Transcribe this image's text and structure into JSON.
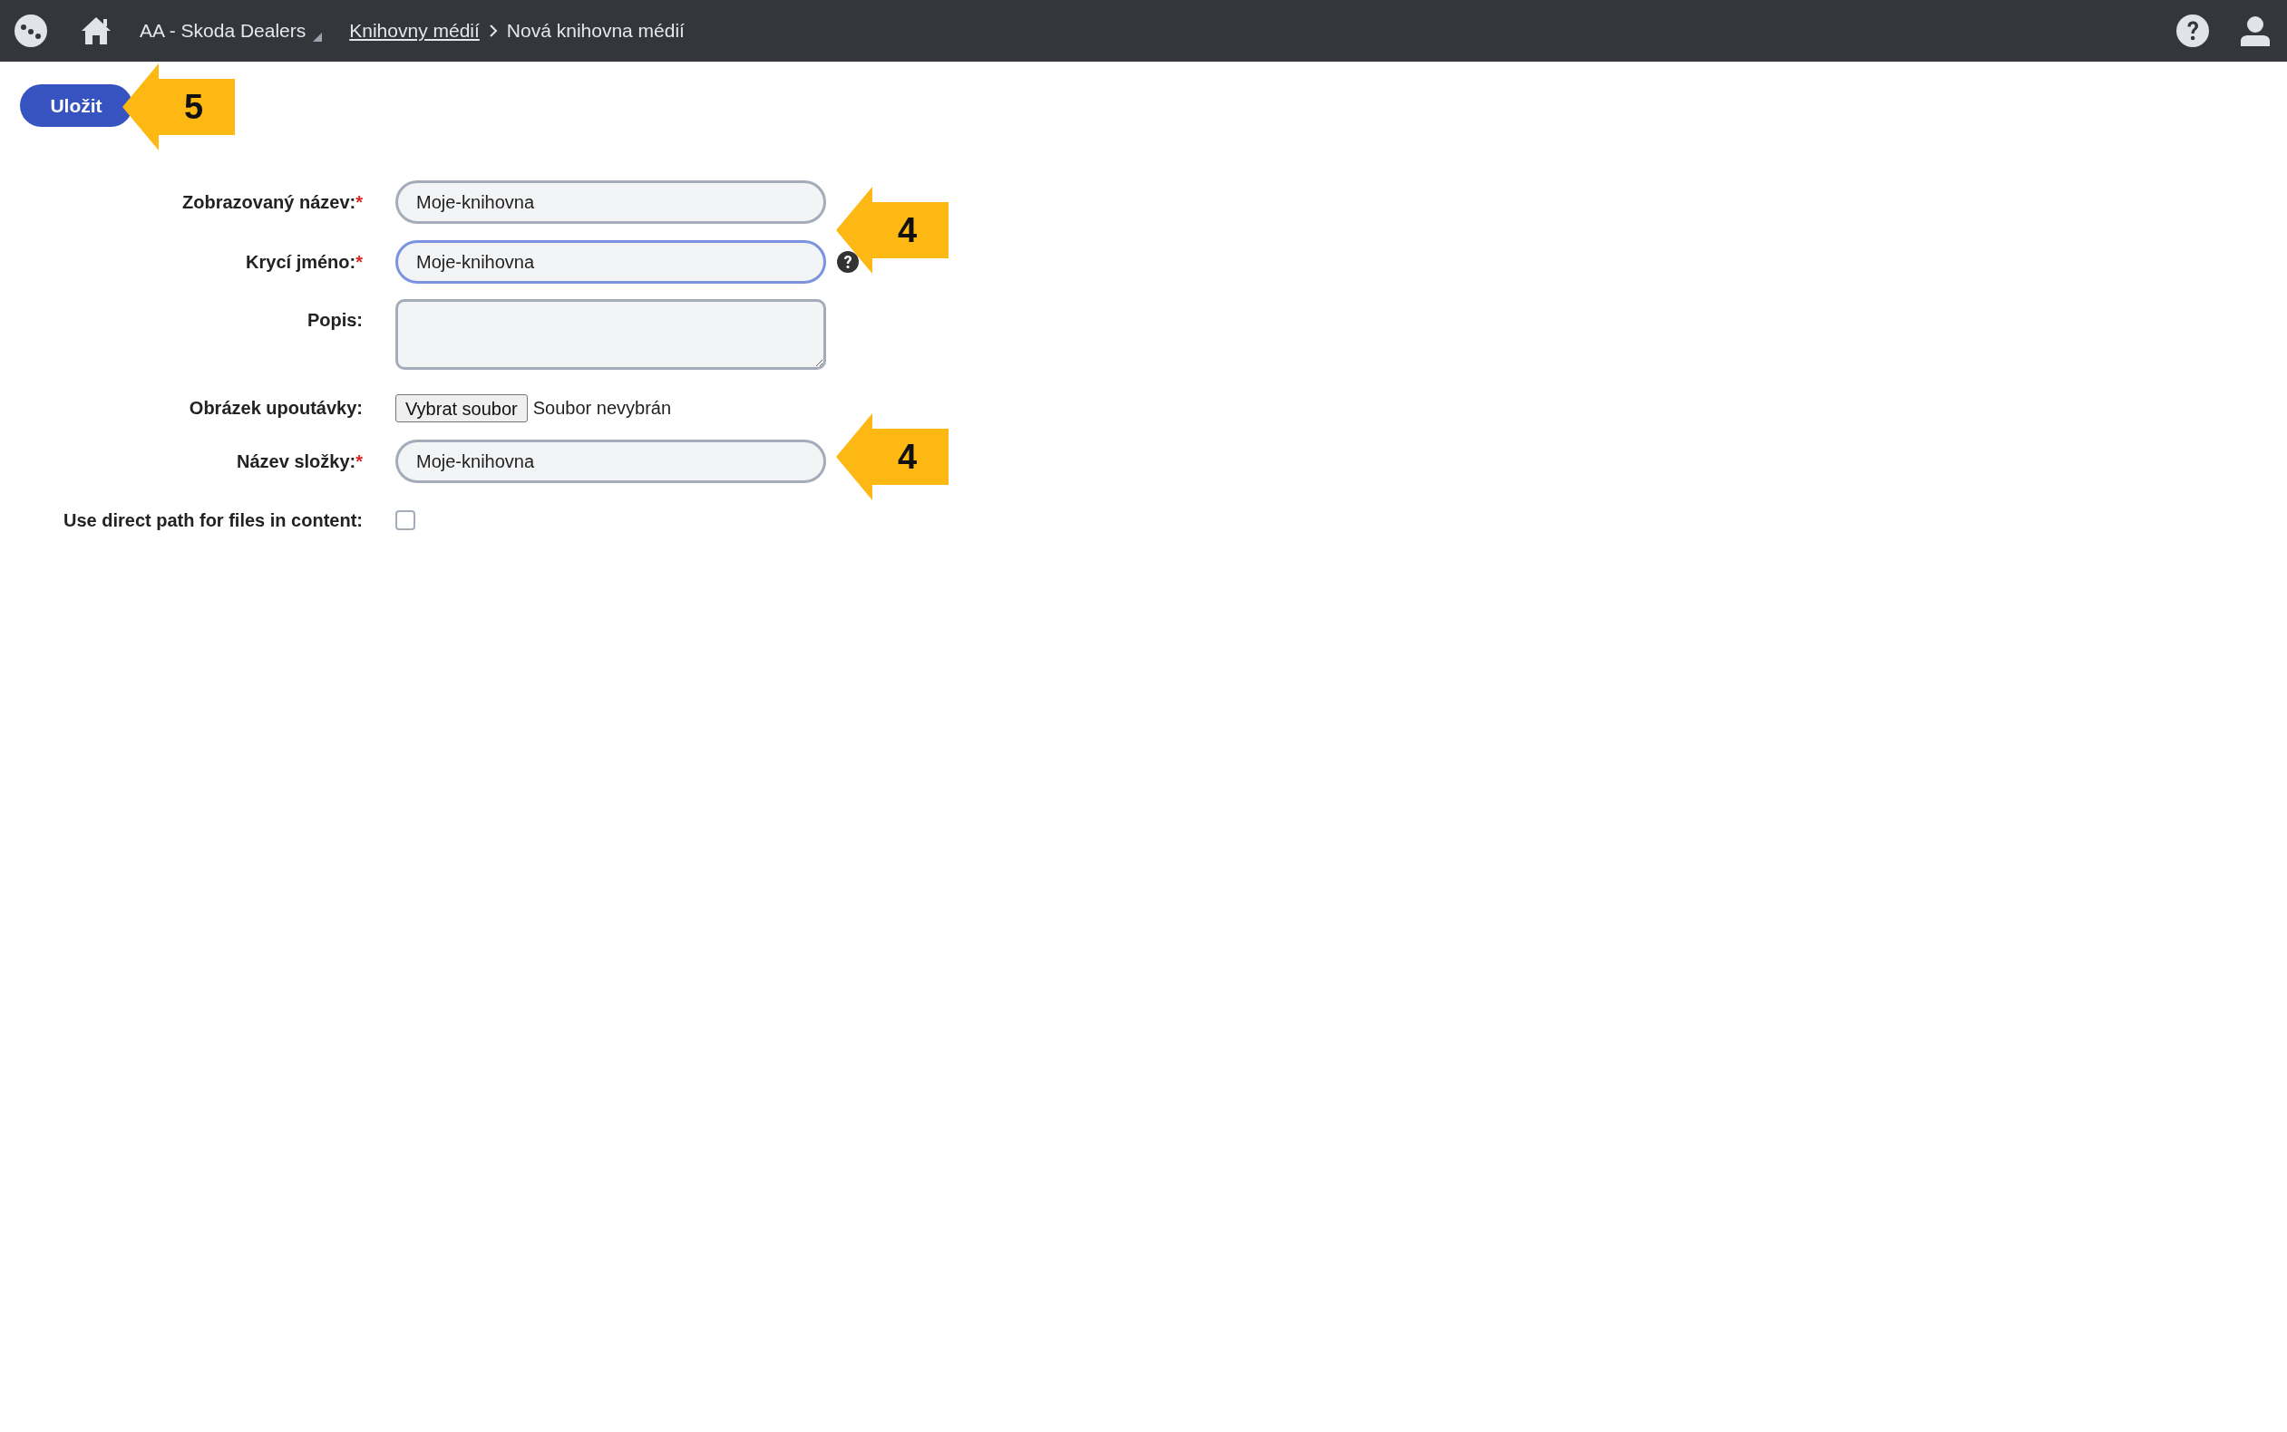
{
  "header": {
    "workspace": "AA - Skoda Dealers",
    "breadcrumb": [
      {
        "label": "Knihovny médií",
        "link": true
      },
      {
        "label": "Nová knihovna médií",
        "link": false
      }
    ]
  },
  "toolbar": {
    "save_button": "Uložit"
  },
  "form": [
    {
      "kind": "text",
      "label": "Zobrazovaný název:",
      "required_mark": "*",
      "value": "Moje-knihovna",
      "focused": false,
      "help": false
    },
    {
      "kind": "text",
      "label": "Krycí jméno:",
      "required_mark": "*",
      "value": "Moje-knihovna",
      "focused": true,
      "help": true
    },
    {
      "kind": "textarea",
      "label": "Popis:"
    },
    {
      "kind": "file",
      "label": "Obrázek upoutávky:",
      "button": "Vybrat soubor",
      "status": "Soubor nevybrán"
    },
    {
      "kind": "text",
      "label": "Název složky:",
      "required_mark": "*",
      "value": "Moje-knihovna",
      "focused": false,
      "help": false
    },
    {
      "kind": "checkbox",
      "label": "Use direct path for files in content:",
      "checked": false
    }
  ],
  "callouts": [
    {
      "number": "5"
    },
    {
      "number": "4"
    },
    {
      "number": "4"
    }
  ]
}
